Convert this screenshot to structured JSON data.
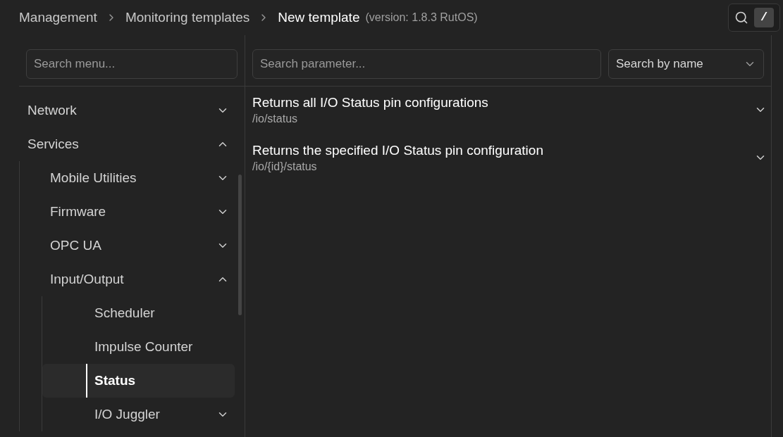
{
  "breadcrumbs": [
    {
      "label": "Management",
      "current": false
    },
    {
      "label": "Monitoring templates",
      "current": false
    },
    {
      "label": "New template",
      "current": true,
      "note": "(version: 1.8.3 RutOS)"
    }
  ],
  "search_shortcut": {
    "key": "/"
  },
  "sidebar": {
    "search": {
      "placeholder": "Search menu..."
    },
    "items": [
      {
        "kind": "group",
        "label": "Network",
        "expanded": false,
        "selected": false
      },
      {
        "kind": "group",
        "label": "Services",
        "expanded": true,
        "selected": false,
        "children": [
          {
            "kind": "group",
            "label": "Mobile Utilities",
            "expanded": false,
            "selected": false
          },
          {
            "kind": "group",
            "label": "Firmware",
            "expanded": false,
            "selected": false
          },
          {
            "kind": "group",
            "label": "OPC UA",
            "expanded": false,
            "selected": false
          },
          {
            "kind": "group",
            "label": "Input/Output",
            "expanded": true,
            "selected": false,
            "children": [
              {
                "kind": "leaf",
                "label": "Scheduler",
                "selected": false
              },
              {
                "kind": "leaf",
                "label": "Impulse Counter",
                "selected": false
              },
              {
                "kind": "leaf",
                "label": "Status",
                "selected": true
              },
              {
                "kind": "group",
                "label": "I/O Juggler",
                "expanded": false,
                "selected": false
              }
            ]
          }
        ]
      }
    ]
  },
  "parameters": {
    "search": {
      "placeholder": "Search parameter..."
    },
    "search_mode": {
      "value": "Search by name"
    },
    "endpoints": [
      {
        "title": "Returns all I/O Status pin configurations",
        "path": "/io/status",
        "expanded": false
      },
      {
        "title": "Returns the specified I/O Status pin configuration",
        "path": "/io/{id}/status",
        "expanded": false
      }
    ]
  }
}
